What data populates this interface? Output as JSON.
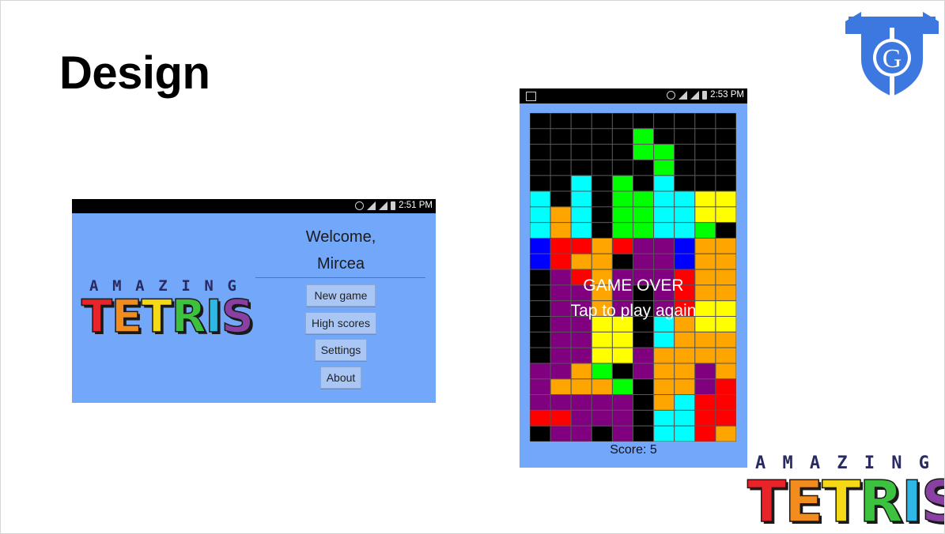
{
  "slide": {
    "title": "Design"
  },
  "phone1": {
    "status_time": "2:51 PM",
    "logo_top": [
      "A",
      "M",
      "A",
      "Z",
      "I",
      "N",
      "G"
    ],
    "logo_letters": [
      {
        "ch": "T",
        "color": "#e8232a"
      },
      {
        "ch": "E",
        "color": "#f28c1e"
      },
      {
        "ch": "T",
        "color": "#f5d916"
      },
      {
        "ch": "R",
        "color": "#3cc23f"
      },
      {
        "ch": "I",
        "color": "#2fb7e6"
      },
      {
        "ch": "S",
        "color": "#8a3fa3"
      }
    ],
    "welcome": "Welcome,",
    "name": "Mircea",
    "buttons": {
      "new_game": "New game",
      "high_scores": "High scores",
      "settings": "Settings",
      "about": "About"
    }
  },
  "phone2": {
    "status_time": "2:53 PM",
    "game_over": "GAME OVER",
    "tap_again": "Tap to play again",
    "score": "Score: 5",
    "colors": {
      "K": "#000000",
      "Y": "#ffff00",
      "C": "#00ffff",
      "G": "#00ff00",
      "O": "#ffa500",
      "R": "#ff0000",
      "B": "#0000ff",
      "P": "#800080"
    },
    "board": [
      "KKKKKKKKKK",
      "KKKKKGKKKK",
      "KKKKKGGKKK",
      "KKKKKKGKKK",
      "KKCKGKCKKK",
      "CKCKGGCCYY",
      "COCKGGCCYY",
      "COCKGGCCGK",
      "BRRORPPBOO",
      "BROOKPPBOO",
      "KPROPPPROO",
      "KPPOPKPROO",
      "KPPOPKPRYY",
      "KPPYYKCOYY",
      "KPPYYKCOOO",
      "KPPYYPOOOO",
      "PPOGKPOOPO",
      "POOOGKOOPR",
      "PPPPPKOCRR",
      "RRPPPKCCRR",
      "KPPKPKCCRO"
    ]
  },
  "logo2": {
    "logo_top": [
      "A",
      "M",
      "A",
      "Z",
      "I",
      "N",
      "G"
    ],
    "logo_letters": [
      {
        "ch": "T",
        "color": "#e8232a"
      },
      {
        "ch": "E",
        "color": "#f28c1e"
      },
      {
        "ch": "T",
        "color": "#f5d916"
      },
      {
        "ch": "R",
        "color": "#3cc23f"
      },
      {
        "ch": "I",
        "color": "#2fb7e6"
      },
      {
        "ch": "S",
        "color": "#8a3fa3"
      }
    ]
  },
  "brand": {
    "shield_letter": "G",
    "shield_color": "#3c78e0"
  }
}
